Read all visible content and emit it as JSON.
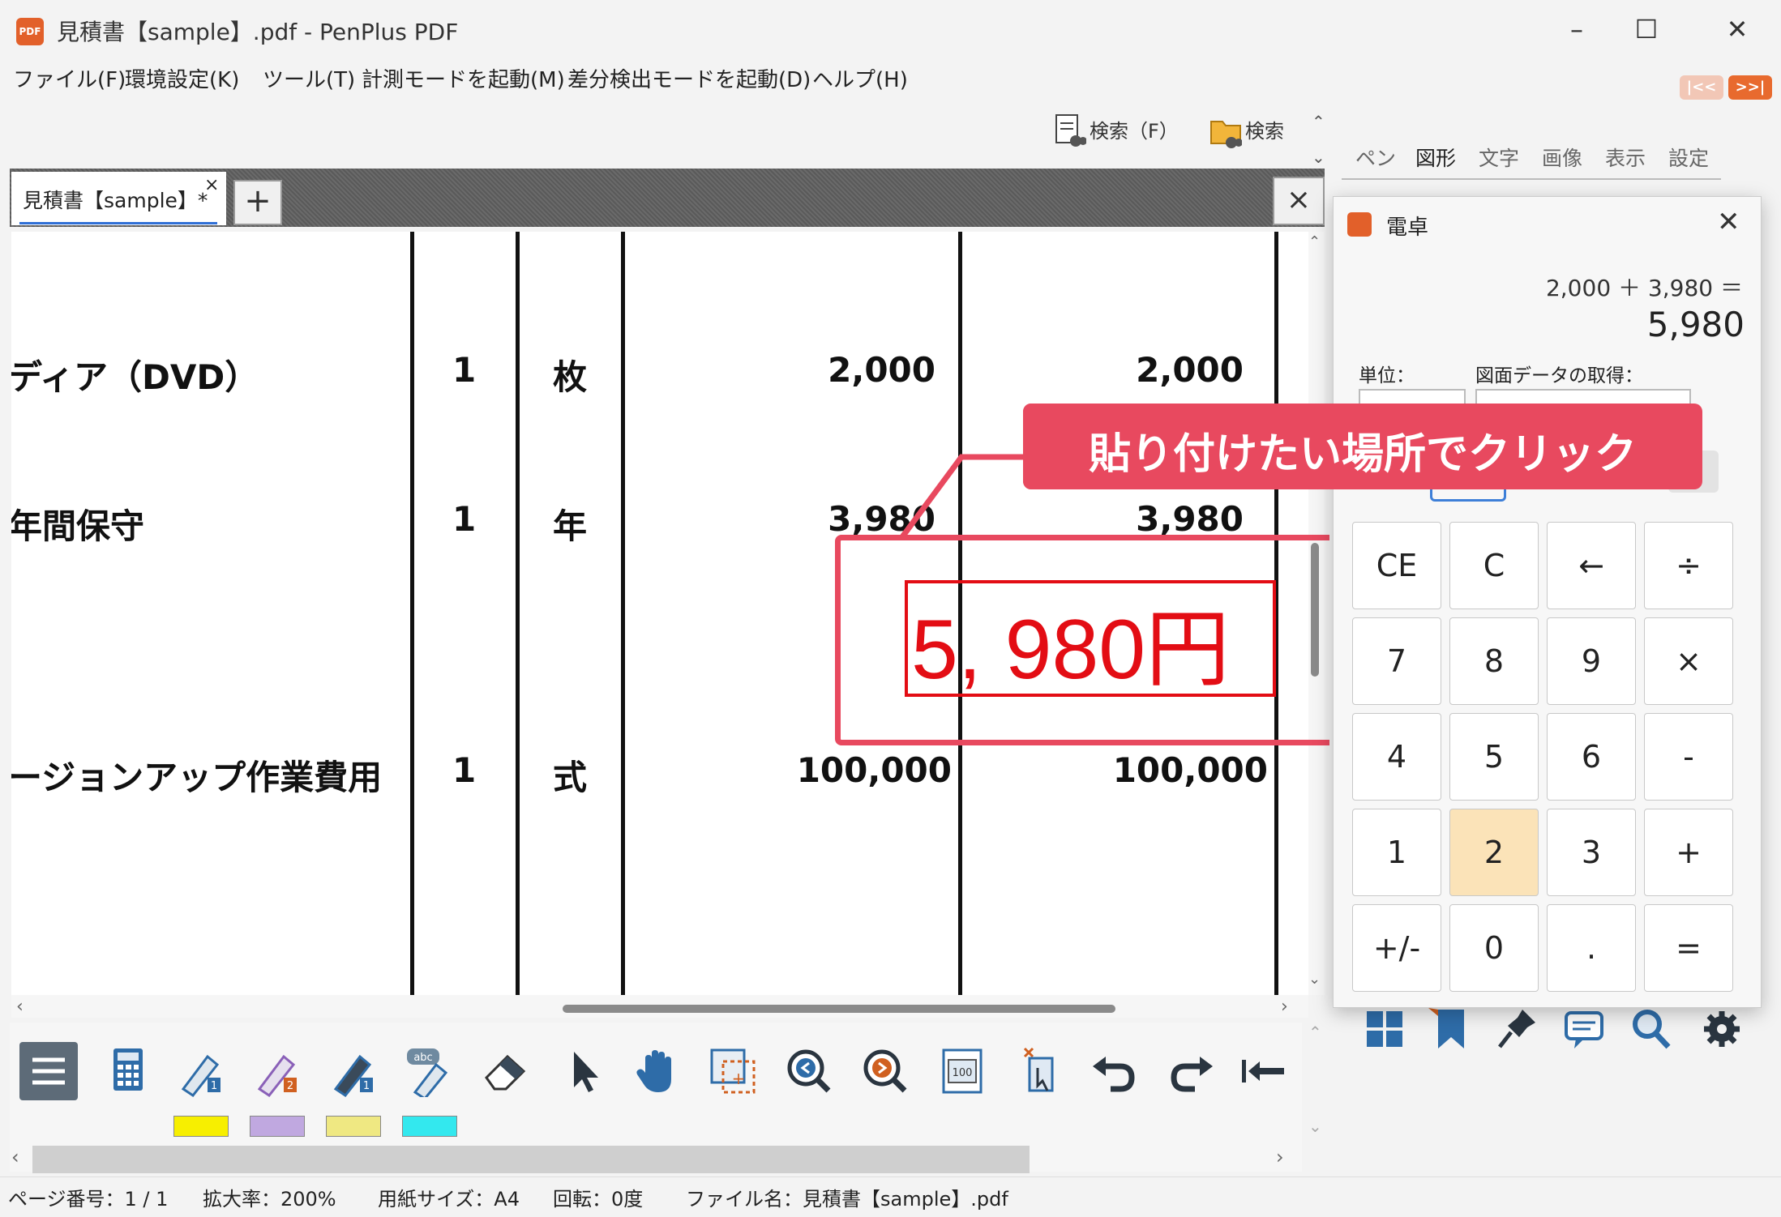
{
  "window": {
    "title": "見積書【sample】.pdf - PenPlus PDF",
    "app_icon_text": "PDF"
  },
  "menu": [
    "ファイル(F)",
    "環境設定(K)",
    "ツール(T)",
    "計測モードを起動(M)",
    "差分検出モードを起動(D)",
    "ヘルプ(H)"
  ],
  "nav_arrows": {
    "prev": "|<<",
    "next": ">>|"
  },
  "search": {
    "file_search_label": "検索（F）",
    "folder_search_label": "検索"
  },
  "tabs": {
    "doc_tab_label": "見積書【sample】*",
    "close_symbol": "×",
    "new_tab_symbol": "+",
    "close_doc_symbol": "×"
  },
  "document": {
    "rows": [
      {
        "item": "ディア（DVD）",
        "qty": "1",
        "unit": "枚",
        "price": "2,000",
        "amount": "2,000"
      },
      {
        "item": "年間保守",
        "qty": "1",
        "unit": "年",
        "price": "3,980",
        "amount": "3,980"
      },
      {
        "item": "ージョンアップ作業費用",
        "qty": "1",
        "unit": "式",
        "price": "100,000",
        "amount": "100,000"
      }
    ],
    "pasted_value": "5, 980円"
  },
  "annotation": {
    "callout": "貼り付けたい場所でクリック",
    "accent_color": "#e8495f"
  },
  "toolbar": {
    "icons": [
      "menu-icon",
      "calculator-icon",
      "pen1-icon",
      "pen2-icon",
      "pen3-icon",
      "text-pen-icon",
      "eraser-icon",
      "select-arrow-icon",
      "hand-icon",
      "area-select-icon",
      "zoom-out-icon",
      "zoom-in-icon",
      "page-fit-icon",
      "stamp-icon",
      "undo-icon",
      "redo-icon",
      "first-page-icon"
    ],
    "swatches": [
      "#f7ef00",
      "#c0a8e0",
      "#efe882",
      "#33e8ee"
    ]
  },
  "status": {
    "page": "ページ番号：1 / 1",
    "zoom": "拡大率：200%",
    "paper": "用紙サイズ：A4",
    "rotation": "回転：0度",
    "filename": "ファイル名：見積書【sample】.pdf"
  },
  "panel": {
    "tabs": [
      "ペン",
      "図形",
      "文字",
      "画像",
      "表示",
      "設定"
    ],
    "active_tab": "図形"
  },
  "calculator": {
    "title": "電卓",
    "expression": "2,000 ＋ 3,980 ＝",
    "result": "5,980",
    "unit_label": "単位：",
    "fetch_label": "図面データの取得：",
    "keys": [
      [
        "CE",
        "C",
        "←",
        "÷"
      ],
      [
        "7",
        "8",
        "9",
        "×"
      ],
      [
        "4",
        "5",
        "6",
        "-"
      ],
      [
        "1",
        "2",
        "3",
        "+"
      ],
      [
        "+/-",
        "0",
        ".",
        "="
      ]
    ],
    "highlighted_key": "2"
  }
}
